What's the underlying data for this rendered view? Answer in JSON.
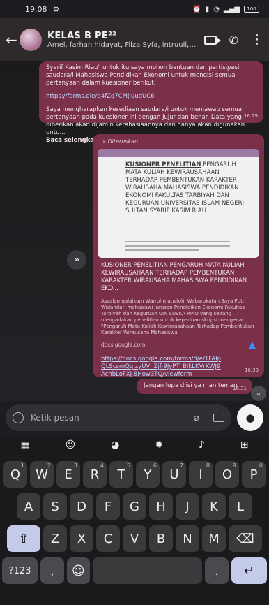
{
  "status": {
    "time": "19.08",
    "battery": "100"
  },
  "header": {
    "title": "KELAS B PE²²",
    "subtitle": "Amel, farhan hidayat, Filza Syfa, intruull, M. ..."
  },
  "messages": {
    "m1": {
      "text": "Syarif Kasim Riau\" untuk itu saya mohon bantuan dan partisipasi saudara/i Mahasiswa Pendidikan Ekonomi untuk mengisi semua pertanyaan dalam kuesioner berikut.",
      "link": "https://forms.gle/g4fZq7CMjJuudUC6",
      "body": "Saya mengharapkan kesediaan saudara/i untuk menjawab semua pertanyaan pada kuesioner ini dengan jujur dan benar. Data yang diberikan akan dijamin kerahasiaannya dan hanya akan digunakan untu...",
      "more": "Baca selengkapnya",
      "time": "16.29"
    },
    "m2": {
      "forwarded": "Diteruskan",
      "preview_title_bold": "KUSIONER PENELITIAN",
      "preview_title_rest": " PENGARUH MATA KULIAH KEWIRAUSAHAAN TERHADAP PEMBENTUKAN KARAKTER WIRAUSAHA MAHASISWA PENDIDIKAN EKONOMI FAKULTAS TARBIYAH DAN KEGURUAN UNIVERSITAS ISLAM NEGERI SULTAN SYARIF KASIM RIAU",
      "heading": "KUSIONER PENELITIAN PENGARUH MATA KULIAH KEWIRAUSAHAAN TERHADAP PEMBENTUKAN KARAKTER WIRAUSAHA MAHASISWA PENDIDIKAN EKO...",
      "description": "Assalamualaikum Warrohmatullohi Wabarokatuh Saya Putri Wulandari mahasiswi jurusan Pendidikan Ekonomi Fakultas Tarbiyah dan Keguruan UIN SUSKA RIAU yang sedang mengadakan penelitian untuk keperluan skripsi mengenai \"Pengaruh Mata Kuliah Kewirausahaan Terhadap Pembentukan Karakter Wirausaha Mahasiswa",
      "domain": "docs.google.com",
      "link": "https://docs.google.com/forms/d/e/1FAIpQLScsmQgIzyUVhZjf-9JyPT_BIkLKVrKWJ9AchbLoFXJ-8How3TQ/viewform",
      "time": "16.30"
    },
    "m3": {
      "text": "Jangan lupa diisi ya man teman",
      "time": "16.31"
    }
  },
  "composer": {
    "placeholder": "Ketik pesan"
  },
  "keyboard": {
    "row1": [
      [
        "Q",
        "1"
      ],
      [
        "W",
        "2"
      ],
      [
        "E",
        "3"
      ],
      [
        "R",
        "4"
      ],
      [
        "T",
        "5"
      ],
      [
        "Y",
        "6"
      ],
      [
        "U",
        "7"
      ],
      [
        "I",
        "8"
      ],
      [
        "O",
        "9"
      ],
      [
        "P",
        "0"
      ]
    ],
    "row2": [
      "A",
      "S",
      "D",
      "F",
      "G",
      "H",
      "J",
      "K",
      "L"
    ],
    "row3": [
      "Z",
      "X",
      "C",
      "V",
      "B",
      "N",
      "M"
    ],
    "sym": "?123",
    "comma": ",",
    "period": "."
  }
}
